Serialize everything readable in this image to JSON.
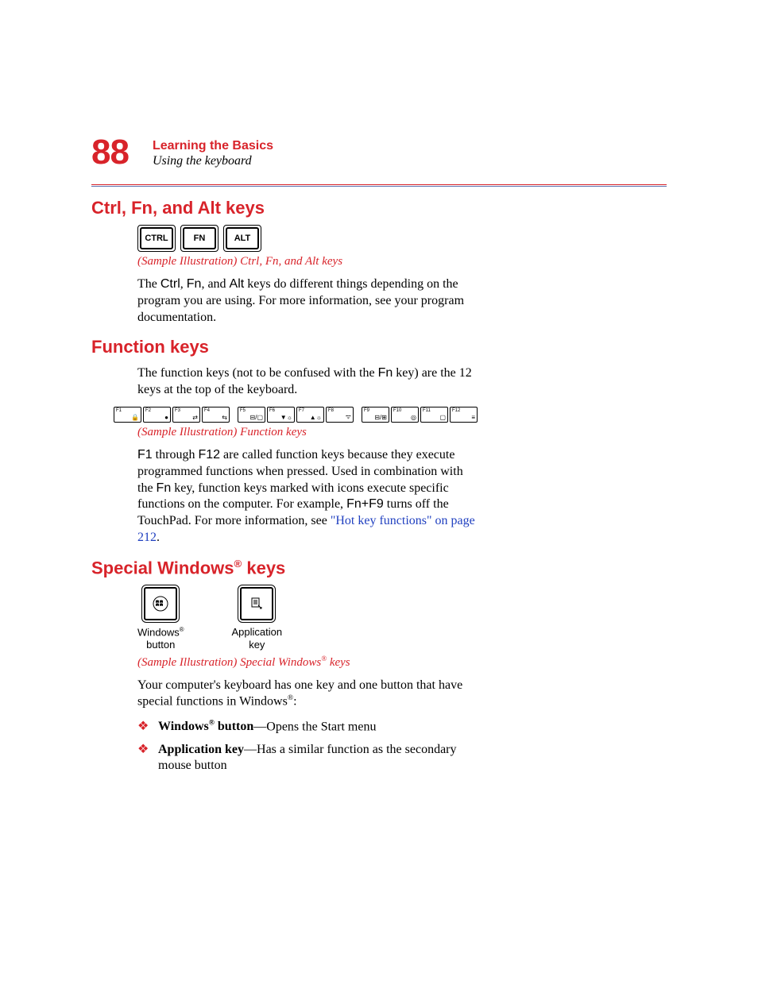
{
  "header": {
    "page_number": "88",
    "chapter": "Learning the Basics",
    "section": "Using the keyboard"
  },
  "s1": {
    "heading": "Ctrl, Fn, and Alt keys",
    "keys": {
      "ctrl": "CTRL",
      "fn": "FN",
      "alt": "ALT"
    },
    "caption": "(Sample Illustration) Ctrl, Fn, and Alt keys",
    "body_a": "The ",
    "body_ctrl": "Ctrl",
    "body_b": ", ",
    "body_fn": "Fn",
    "body_c": ", and ",
    "body_alt": "Alt",
    "body_d": " keys do different things depending on the program you are using. For more information, see your program documentation."
  },
  "s2": {
    "heading": "Function keys",
    "intro_a": "The function keys (not to be confused with the ",
    "intro_fn": "Fn",
    "intro_b": " key) are the 12 keys at the top of the keyboard.",
    "fkeys": [
      "F1",
      "F2",
      "F3",
      "F4",
      "F5",
      "F6",
      "F7",
      "F8",
      "F9",
      "F10",
      "F11",
      "F12"
    ],
    "ficons": [
      "🔒",
      "●",
      "⇄",
      "⇆",
      "⊟/▢",
      "▼☼",
      "▲☼",
      "ᯤ",
      "⊟/⊞",
      "◎",
      "▢",
      "≡"
    ],
    "caption": "(Sample Illustration) Function keys",
    "body_a": "F1",
    "body_b": " through ",
    "body_c": "F12",
    "body_d": " are called function keys because they execute programmed functions when pressed. Used in combination with the ",
    "body_e": "Fn",
    "body_f": " key, function keys marked with icons execute specific functions on the computer. For example, ",
    "body_g": "Fn+F9",
    "body_h": " turns off the TouchPad. For more information, see ",
    "link": "\"Hot key functions\" on page 212",
    "body_i": "."
  },
  "s3": {
    "heading_a": "Special Windows",
    "heading_b": " keys",
    "winlabel_a": "Windows",
    "winlabel_b": "button",
    "applabel_a": "Application",
    "applabel_b": "key",
    "caption_a": "(Sample Illustration) Special Windows",
    "caption_b": " keys",
    "intro_a": "Your computer's keyboard has one key and one button that have special functions in Windows",
    "intro_b": ":",
    "bullet1_a": "Windows",
    "bullet1_b": " button",
    "bullet1_c": "—Opens the Start menu",
    "bullet2_a": "Application key",
    "bullet2_b": "—Has a similar function as the secondary mouse button"
  }
}
